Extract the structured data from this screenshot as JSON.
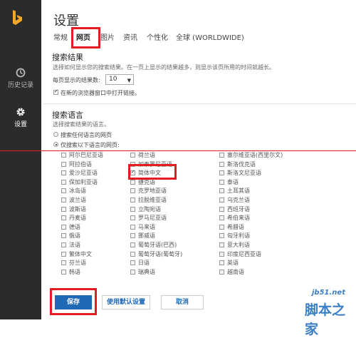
{
  "window": {
    "title": "设置"
  },
  "sidebar": {
    "items": [
      {
        "label": "历史记录",
        "icon": "history-icon"
      },
      {
        "label": "设置",
        "icon": "gear-icon"
      }
    ]
  },
  "tabs": [
    "常规",
    "网页",
    "图片",
    "资讯",
    "个性化",
    "全球 (WORLDWIDE)"
  ],
  "active_tab": "网页",
  "search_results": {
    "heading": "搜索结果",
    "description": "选择如何显示您的搜索结果。在一页上显示的结果越多，则显示该页所用的时间就越长。",
    "per_page_label": "每页显示的结果数:",
    "per_page_value": "10",
    "new_window_label": "在新的浏览器窗口中打开链接。",
    "new_window_checked": true
  },
  "search_language": {
    "heading": "搜索语言",
    "description": "选择搜索结果的语言。",
    "option_any": "搜索任何语言的网页",
    "option_selected": "仅搜索以下语言的网页:",
    "selected_option": "option_selected",
    "languages": [
      [
        "阿尔巴尼亚语",
        "荷兰语",
        "塞尔维亚语(西里尔文)"
      ],
      [
        "阿拉伯语",
        "加泰罗尼亚语",
        "斯洛伐克语"
      ],
      [
        "爱沙尼亚语",
        "简体中文",
        "斯洛文尼亚语"
      ],
      [
        "保加利亚语",
        "捷克语",
        "泰语"
      ],
      [
        "冰岛语",
        "克罗地亚语",
        "土耳其语"
      ],
      [
        "波兰语",
        "拉脱维亚语",
        "乌克兰语"
      ],
      [
        "波斯语",
        "立陶宛语",
        "西班牙语"
      ],
      [
        "丹麦语",
        "罗马尼亚语",
        "希伯来语"
      ],
      [
        "德语",
        "马来语",
        "希腊语"
      ],
      [
        "俄语",
        "挪威语",
        "匈牙利语"
      ],
      [
        "法语",
        "葡萄牙语(巴西)",
        "意大利语"
      ],
      [
        "繁体中文",
        "葡萄牙语(葡萄牙)",
        "印度尼西亚语"
      ],
      [
        "芬兰语",
        "日语",
        "英语"
      ],
      [
        "韩语",
        "瑞典语",
        "越南语"
      ]
    ],
    "checked": "简体中文"
  },
  "buttons": {
    "save": "保存",
    "default": "使用默认设置",
    "cancel": "取消"
  },
  "watermark": {
    "line1": "jb51.net",
    "line2": "脚本之家"
  },
  "colors": {
    "sidebar_bg": "#2b2b2b",
    "accent_blue": "#1f69b4",
    "highlight_red": "#e31b23"
  }
}
